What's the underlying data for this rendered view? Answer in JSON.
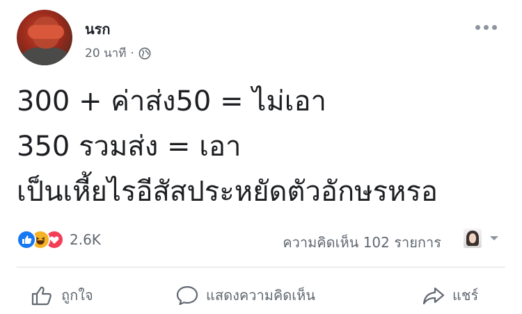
{
  "post": {
    "author": "นรก",
    "time": "20 นาที",
    "separator": "·",
    "text_lines": [
      "300 + ค่าส่ง50 = ไม่เอา",
      "350 รวมส่ง = เอา",
      "เป็นเหี้ยไรอีสัสประหยัดตัวอักษรหรอ"
    ]
  },
  "stats": {
    "reactions_count": "2.6K",
    "comments": "ความคิดเห็น 102 รายการ"
  },
  "actions": {
    "like": "ถูกใจ",
    "comment": "แสดงความคิดเห็น",
    "share": "แชร์"
  },
  "colors": {
    "like_blue": "#1877f2",
    "haha_yellow": "#f7b125",
    "love_red": "#f33e58",
    "secondary_text": "#606770"
  }
}
